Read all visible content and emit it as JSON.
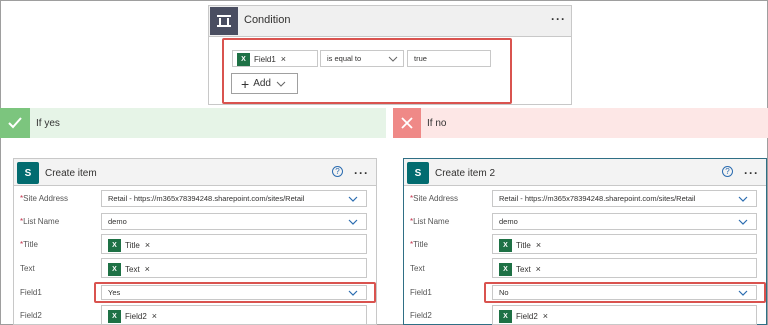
{
  "condition": {
    "title": "Condition",
    "more": "···",
    "left_token": "Field1",
    "operator": "is equal to",
    "value": "true",
    "add_label": "Add",
    "icon": "condition-icon"
  },
  "if_yes": {
    "label": "If yes",
    "card": {
      "title": "Create item",
      "help": "?",
      "more": "···",
      "fields": {
        "site_address": {
          "label": "Site Address",
          "required": true,
          "value": "Retail - https://m365x78394248.sharepoint.com/sites/Retail"
        },
        "list_name": {
          "label": "List Name",
          "required": true,
          "value": "demo"
        },
        "title": {
          "label": "Title",
          "required": true,
          "token": "Title"
        },
        "text": {
          "label": "Text",
          "token": "Text"
        },
        "field1": {
          "label": "Field1",
          "value": "Yes"
        },
        "field2": {
          "label": "Field2",
          "token": "Field2"
        }
      }
    }
  },
  "if_no": {
    "label": "If no",
    "card": {
      "title": "Create item 2",
      "help": "?",
      "more": "···",
      "fields": {
        "site_address": {
          "label": "Site Address",
          "required": true,
          "value": "Retail - https://m365x78394248.sharepoint.com/sites/Retail"
        },
        "list_name": {
          "label": "List Name",
          "required": true,
          "value": "demo"
        },
        "title": {
          "label": "Title",
          "required": true,
          "token": "Title"
        },
        "text": {
          "label": "Text",
          "token": "Text"
        },
        "field1": {
          "label": "Field1",
          "value": "No"
        },
        "field2": {
          "label": "Field2",
          "token": "Field2"
        }
      }
    }
  },
  "icons": {
    "excel": "X",
    "sharepoint": "S"
  },
  "colors": {
    "highlight": "#d9534f",
    "yes_bg": "#e6f4e7",
    "no_bg": "#fde7e6",
    "sharepoint": "#036c70",
    "excel": "#1e7145"
  }
}
